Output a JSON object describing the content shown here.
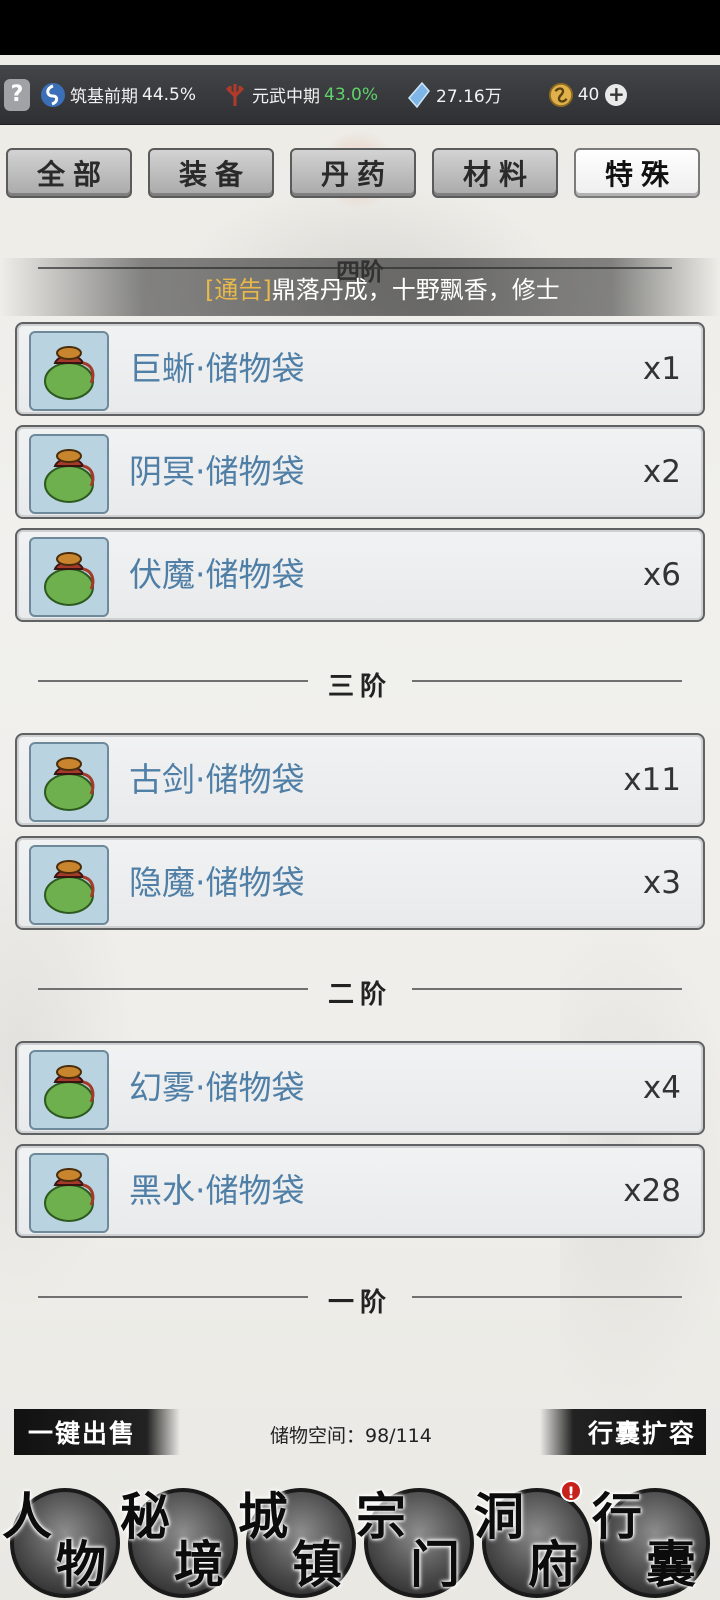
{
  "status": {
    "help_label": "?",
    "realm": {
      "name": "筑基前期",
      "pct": "44.5%"
    },
    "martial": {
      "name": "元武中期",
      "pct": "43.0%"
    },
    "stones": "27.16万",
    "gold": "40",
    "plus_label": "+"
  },
  "tabs": [
    {
      "label": "全部",
      "active": false
    },
    {
      "label": "装备",
      "active": false
    },
    {
      "label": "丹药",
      "active": false
    },
    {
      "label": "材料",
      "active": false
    },
    {
      "label": "特殊",
      "active": true
    }
  ],
  "notice": {
    "tag": "[通告]",
    "text": "鼎落丹成，十野飘香，修士",
    "tier_label": "四阶"
  },
  "groups": {
    "tier3_label": "三阶",
    "tier2_label": "二阶",
    "tier1_label": "一阶"
  },
  "items": [
    {
      "name": "巨蜥·储物袋",
      "qty": "x1"
    },
    {
      "name": "阴冥·储物袋",
      "qty": "x2"
    },
    {
      "name": "伏魔·储物袋",
      "qty": "x6"
    },
    {
      "name": "古剑·储物袋",
      "qty": "x11"
    },
    {
      "name": "隐魔·储物袋",
      "qty": "x3"
    },
    {
      "name": "幻雾·储物袋",
      "qty": "x4"
    },
    {
      "name": "黑水·储物袋",
      "qty": "x28"
    }
  ],
  "actions": {
    "sell_label": "一键出售",
    "storage_text": "储物空间：98/114",
    "expand_label": "行囊扩容"
  },
  "nav": [
    {
      "c1": "人",
      "c2": "物"
    },
    {
      "c1": "秘",
      "c2": "境"
    },
    {
      "c1": "城",
      "c2": "镇"
    },
    {
      "c1": "宗",
      "c2": "门"
    },
    {
      "c1": "洞",
      "c2": "府",
      "badge": "!"
    },
    {
      "c1": "行",
      "c2": "囊"
    }
  ],
  "colors": {
    "accent_green": "#5fd36a",
    "item_name": "#4f7fa6",
    "notice_tag": "#e8b84a",
    "badge": "#c8211b"
  }
}
